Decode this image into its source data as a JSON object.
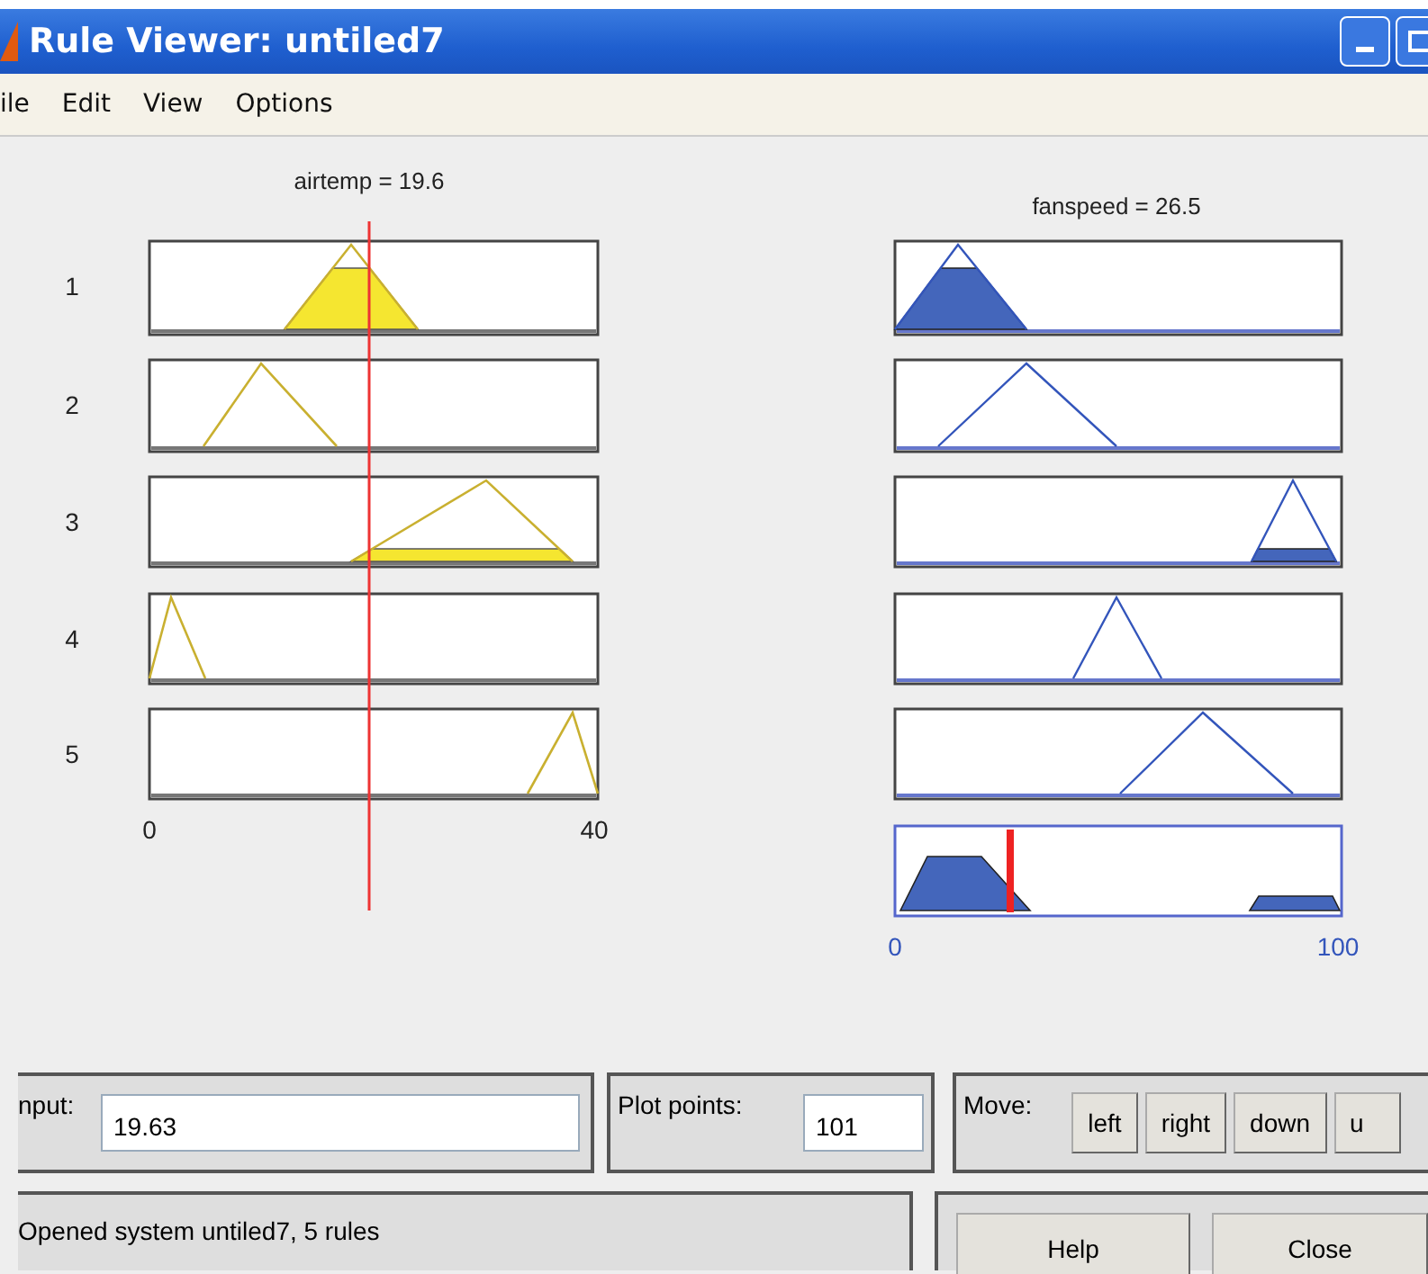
{
  "window": {
    "title": "Rule Viewer: untiled7"
  },
  "menu": [
    "ile",
    "Edit",
    "View",
    "Options"
  ],
  "input_variable": {
    "label": "airtemp = 19.6",
    "ticks": [
      "0",
      "40"
    ]
  },
  "output_variable": {
    "label": "fanspeed = 26.5",
    "ticks": [
      "0",
      "100"
    ]
  },
  "rules": [
    {
      "number": "1"
    },
    {
      "number": "2"
    },
    {
      "number": "3"
    },
    {
      "number": "4"
    },
    {
      "number": "5"
    }
  ],
  "input_panel": {
    "label": "nput:",
    "value": "19.63"
  },
  "plot_points": {
    "label": "Plot points:",
    "value": "101"
  },
  "move": {
    "label": "Move:",
    "buttons": [
      "left",
      "right",
      "down",
      "u"
    ]
  },
  "status_bar": {
    "text": "Opened system untiled7, 5 rules"
  },
  "buttons": [
    "Help",
    "Close"
  ]
}
